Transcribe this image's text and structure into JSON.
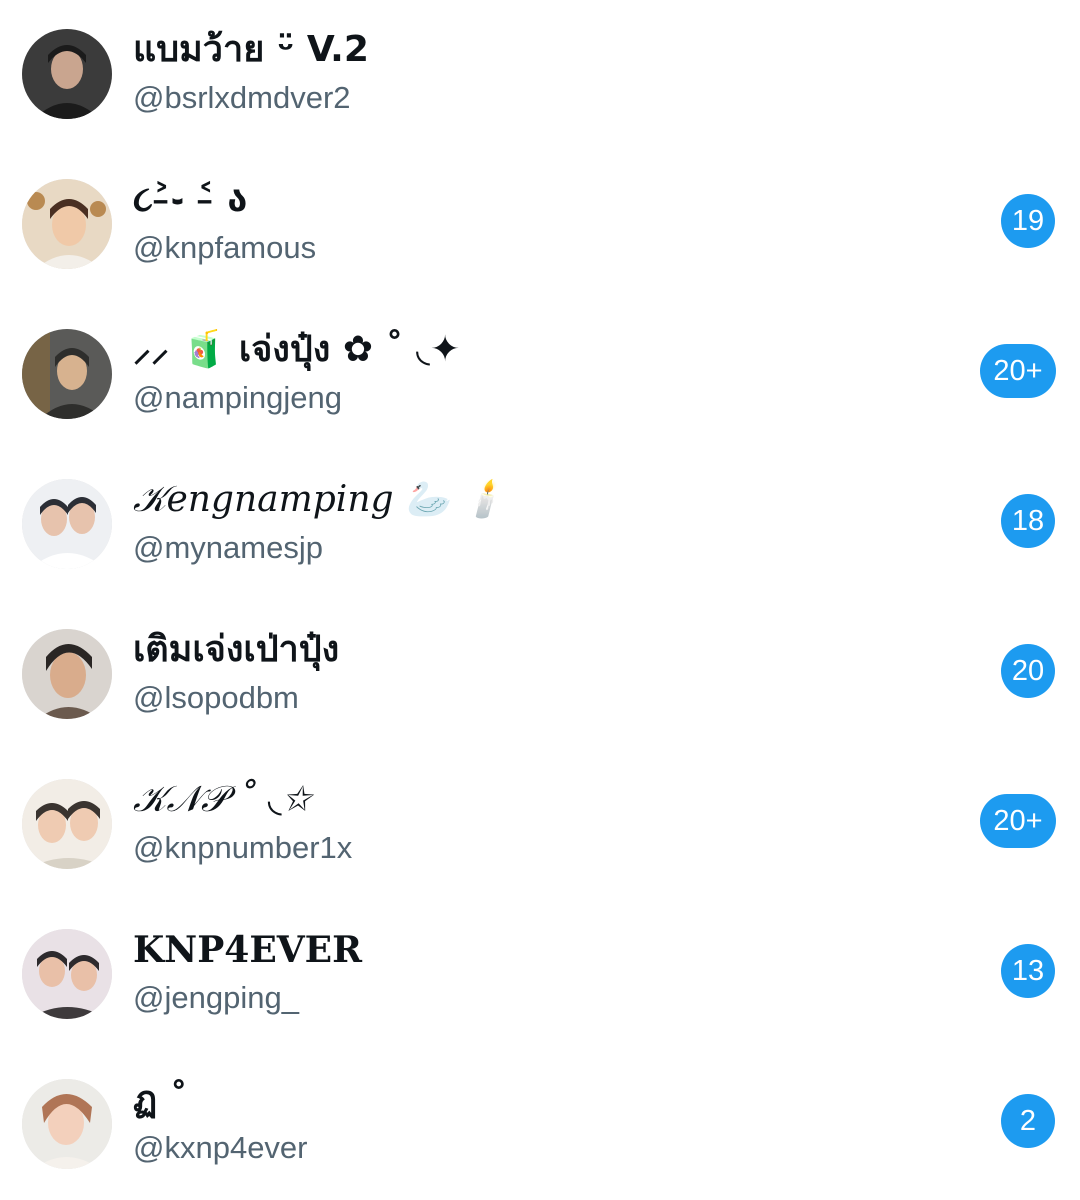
{
  "conversations": [
    {
      "display_name": "แบมว้าย ᵕ̈ V.2",
      "handle": "@bsrlxdmdver2",
      "unread": "",
      "avatar_colors": [
        "#3b3b3b",
        "#1b1b1b",
        "#c9a58f"
      ]
    },
    {
      "display_name": "૮˃̵֊ ˂̵ ა",
      "handle": "@knpfamous",
      "unread": "19",
      "avatar_colors": [
        "#e8d9c4",
        "#b98a52",
        "#f0c9a8"
      ]
    },
    {
      "display_name": "⸝⸝ 🧃 เจ่งปุ๋ง ✿ ˚ ◟✦",
      "handle": "@nampingjeng",
      "unread": "20+",
      "avatar_colors": [
        "#5a5a58",
        "#2e2e2c",
        "#d7b28f"
      ]
    },
    {
      "display_name": "𝒦engnamping 🦢 🕯️",
      "handle": "@mynamesjp",
      "unread": "18",
      "avatar_colors": [
        "#eef0f3",
        "#2c2f36",
        "#e7c3ad"
      ]
    },
    {
      "display_name": "เติมเจ่งเป่าปุ๋ง",
      "handle": "@lsopodbm",
      "unread": "20",
      "avatar_colors": [
        "#d9d4cf",
        "#2a2624",
        "#d9ac8c"
      ]
    },
    {
      "display_name": "𝒦𝒩𝒫 ˚ ◟✩",
      "handle": "@knpnumber1x",
      "unread": "20+",
      "avatar_colors": [
        "#f2ede6",
        "#3a3430",
        "#efcbb2"
      ]
    },
    {
      "display_name": "KNP4EVER",
      "handle": "@jengping_",
      "unread": "13",
      "avatar_colors": [
        "#e9e1e6",
        "#2d2a2d",
        "#e9c0a8"
      ]
    },
    {
      "display_name": "ฏ ˚",
      "handle": "@kxnp4ever",
      "unread": "2",
      "avatar_colors": [
        "#ecebe7",
        "#b07556",
        "#f3d0bc"
      ]
    }
  ],
  "colors": {
    "badge": "#1d9bf0",
    "name_text": "#0f1419",
    "handle_text": "#536471"
  }
}
